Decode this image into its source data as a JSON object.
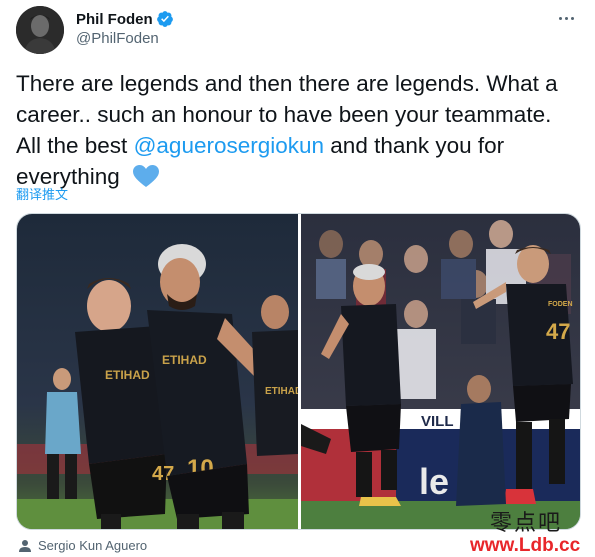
{
  "author": {
    "display_name": "Phil Foden",
    "handle": "@PhilFoden",
    "verified": true,
    "avatar_icon": "profile-photo"
  },
  "tweet": {
    "text_before": "There are legends and then there are legends. What a career.. such an honour to have been your teammate. All the best ",
    "mention": "@aguerosergiokun",
    "text_after": " and thank you for everything",
    "emoji": "blue-heart-icon",
    "translate_label": "翻译推文"
  },
  "media": {
    "photos": [
      {
        "kit_text_left": "ETIHAD",
        "kit_text_right": "ETIHAD",
        "number": "10",
        "number2": "47"
      },
      {
        "kit_name": "FODEN",
        "number": "47",
        "board_text": "VILL",
        "board_text2": "le"
      }
    ]
  },
  "tagged": {
    "icon": "person-icon",
    "label": "Sergio Kun Aguero"
  },
  "watermark": {
    "chinese": "零点吧",
    "url": "www.Ldb.cc"
  },
  "colors": {
    "accent": "#1d9bf0",
    "text": "#0f1419",
    "secondary": "#536471",
    "watermark_red": "#e8262a"
  }
}
